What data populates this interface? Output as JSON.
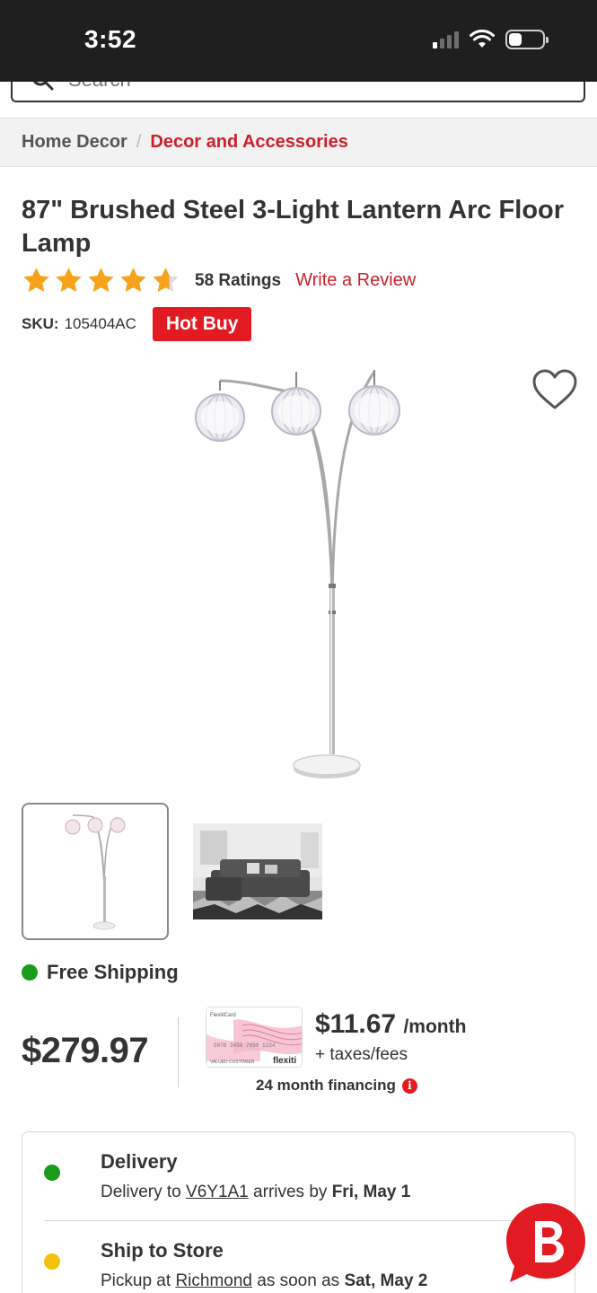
{
  "status_bar": {
    "time": "3:52"
  },
  "search": {
    "placeholder": "Search"
  },
  "breadcrumb": {
    "home": "Home Decor",
    "separator": "/",
    "current": "Decor and Accessories"
  },
  "product": {
    "title": "87\" Brushed Steel 3-Light Lantern Arc Floor Lamp",
    "rating": 4.5,
    "ratings_count": "58 Ratings",
    "write_review": "Write a Review",
    "sku_label": "SKU:",
    "sku": "105404AC",
    "badge": "Hot Buy",
    "price": "$279.97",
    "monthly_price": "$11.67",
    "monthly_suffix": "/month",
    "taxes": "+ taxes/fees",
    "financing": "24 month financing"
  },
  "shipping": {
    "free_label": "Free Shipping"
  },
  "fulfillment": {
    "delivery": {
      "title": "Delivery",
      "prefix": "Delivery to ",
      "postal": "V6Y1A1",
      "middle": " arrives by ",
      "date": "Fri, May 1"
    },
    "ship_to_store": {
      "title": "Ship to Store",
      "prefix": "Pickup at ",
      "store": "Richmond",
      "middle": " as soon as ",
      "date": "Sat, May 2"
    }
  },
  "card": {
    "brand": "flexiti",
    "card_name": "FlexitiCard",
    "holder": "VALUED CUSTOMER"
  },
  "colors": {
    "brand_red": "#e21b23",
    "link_red": "#cc1f2b",
    "star_orange": "#f7a21b",
    "status_green": "#1a9c1a",
    "status_yellow": "#f4c20d"
  },
  "icons": [
    "search-icon",
    "heart-icon",
    "star-icon",
    "info-icon",
    "chat-icon"
  ]
}
